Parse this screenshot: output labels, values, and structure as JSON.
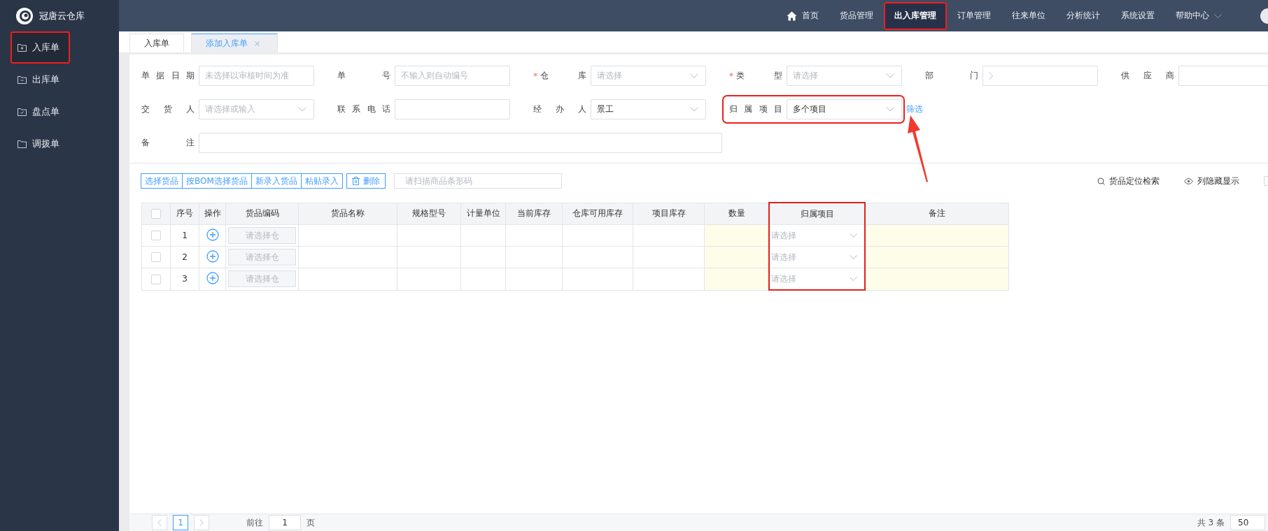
{
  "app": {
    "name": "冠唐云仓库"
  },
  "sidebar": {
    "items": [
      {
        "label": "入库单",
        "kind": "plus",
        "selected": true,
        "highlighted": true
      },
      {
        "label": "出库单",
        "kind": "minus",
        "selected": false,
        "highlighted": false
      },
      {
        "label": "盘点单",
        "kind": "check",
        "selected": false,
        "highlighted": false
      },
      {
        "label": "调拨单",
        "kind": "plain",
        "selected": false,
        "highlighted": false
      }
    ]
  },
  "nav": {
    "items": [
      {
        "label": "首页",
        "kind": "home",
        "selected": false,
        "highlighted": false
      },
      {
        "label": "货品管理",
        "kind": "plain",
        "selected": false,
        "highlighted": false
      },
      {
        "label": "出入库管理",
        "kind": "plain",
        "selected": true,
        "highlighted": true
      },
      {
        "label": "订单管理",
        "kind": "plain",
        "selected": false,
        "highlighted": false
      },
      {
        "label": "往来单位",
        "kind": "plain",
        "selected": false,
        "highlighted": false
      },
      {
        "label": "分析统计",
        "kind": "plain",
        "selected": false,
        "highlighted": false
      },
      {
        "label": "系统设置",
        "kind": "plain",
        "selected": false,
        "highlighted": false
      },
      {
        "label": "帮助中心",
        "kind": "dropdown",
        "selected": false,
        "highlighted": false
      }
    ]
  },
  "tabs": [
    {
      "label": "入库单",
      "selected": false,
      "closable": false
    },
    {
      "label": "添加入库单",
      "selected": true,
      "closable": true
    }
  ],
  "form": {
    "rows": [
      [
        {
          "label": "单据日期",
          "kind": "text",
          "placeholder": "未选择以审核时间为准",
          "highlighted": false
        },
        {
          "label": "单号",
          "kind": "text",
          "placeholder": "不输入则自动编号",
          "highlighted": false
        },
        {
          "label": "仓库",
          "kind": "select",
          "required_mark": "*",
          "placeholder": "请选择",
          "highlighted": false
        },
        {
          "label": "类型",
          "kind": "select",
          "required_mark": "*",
          "placeholder": "请选择",
          "highlighted": false
        },
        {
          "label": "部门",
          "kind": "cascade",
          "highlighted": false
        },
        {
          "label": "供应商",
          "kind": "text",
          "highlighted": false
        }
      ],
      [
        {
          "label": "交货人",
          "kind": "select",
          "placeholder": "请选择或输入",
          "highlighted": false
        },
        {
          "label": "联系电话",
          "kind": "text",
          "highlighted": false
        },
        {
          "label": "经办人",
          "kind": "select",
          "value": "景工",
          "highlighted": false
        },
        {
          "label": "归属项目",
          "kind": "select",
          "value": "多个项目",
          "highlighted": true,
          "link": "筛选"
        }
      ],
      [
        {
          "label": "备注",
          "kind": "wide",
          "highlighted": false
        }
      ]
    ]
  },
  "toolbar": {
    "buttons": [
      "选择货品",
      "按BOM选择货品",
      "新录入货品",
      "粘贴录入"
    ],
    "delete_button": "删除",
    "barcode_placeholder": "请扫描商品条形码",
    "tools": [
      {
        "label": "货品定位检索",
        "kind": "search"
      },
      {
        "label": "列隐藏显示",
        "kind": "eye"
      }
    ],
    "edge_checkbox": {
      "checked": false
    }
  },
  "table": {
    "select_all": {
      "checked": false
    },
    "columns": [
      {
        "label": "序号",
        "highlighted": false
      },
      {
        "label": "操作",
        "highlighted": false
      },
      {
        "label": "货品编码",
        "highlighted": false
      },
      {
        "label": "货品名称",
        "highlighted": false
      },
      {
        "label": "规格型号",
        "highlighted": false
      },
      {
        "label": "计量单位",
        "highlighted": false
      },
      {
        "label": "当前库存",
        "highlighted": false
      },
      {
        "label": "仓库可用库存",
        "highlighted": false
      },
      {
        "label": "项目库存",
        "highlighted": false
      },
      {
        "label": "数量",
        "highlighted": false
      },
      {
        "label": "归属项目",
        "highlighted": true
      },
      {
        "label": "备注",
        "highlighted": false
      }
    ],
    "rows": [
      {
        "checked": false,
        "index": "1",
        "code_placeholder": "请选择仓",
        "project_placeholder": "请选择"
      },
      {
        "checked": false,
        "index": "2",
        "code_placeholder": "请选择仓",
        "project_placeholder": "请选择"
      },
      {
        "checked": false,
        "index": "3",
        "code_placeholder": "请选择仓",
        "project_placeholder": "请选择"
      }
    ]
  },
  "pagination": {
    "pages": [
      {
        "label": "1",
        "selected": true
      }
    ],
    "goto_label": "前往",
    "goto_value": "1",
    "page_unit": "页",
    "total": "共 3 条",
    "page_size": "50"
  }
}
